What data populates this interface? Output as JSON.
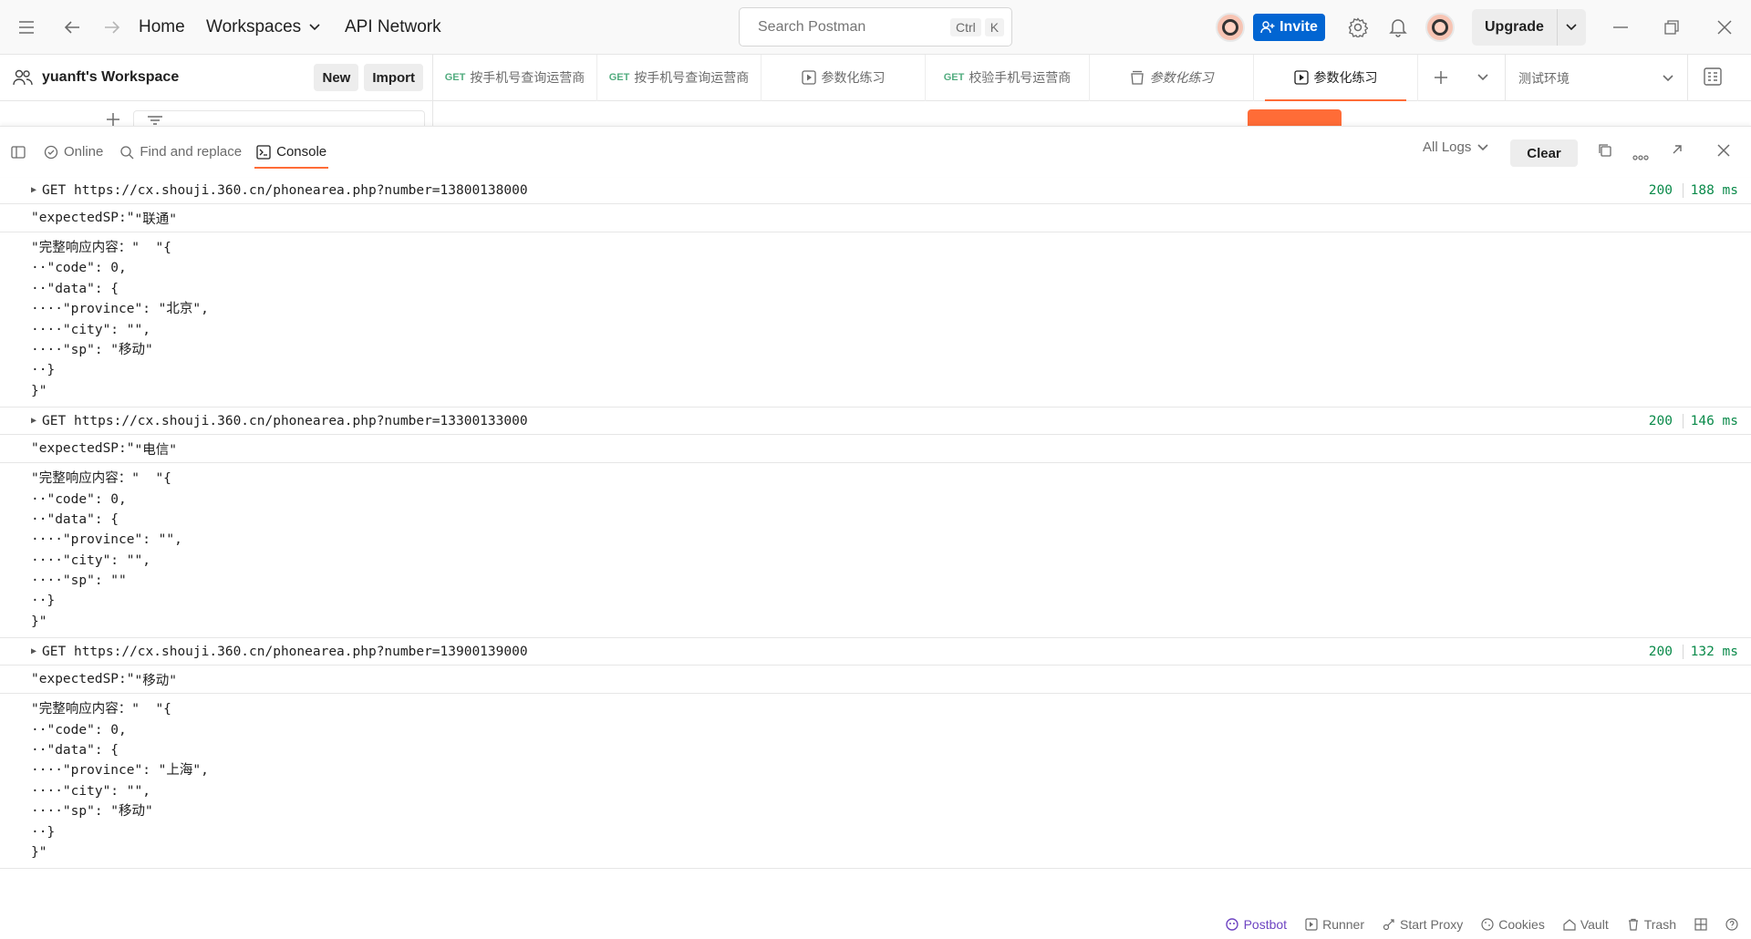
{
  "header": {
    "nav": {
      "home": "Home",
      "workspaces": "Workspaces",
      "api_network": "API Network"
    },
    "search": {
      "placeholder": "Search Postman",
      "shortcut_ctrl": "Ctrl",
      "shortcut_key": "K"
    },
    "invite_label": "Invite",
    "upgrade_label": "Upgrade"
  },
  "workspace": {
    "name": "yuanft's Workspace",
    "new_label": "New",
    "import_label": "Import"
  },
  "tabs": [
    {
      "method": "GET",
      "label": "按手机号查询运营商"
    },
    {
      "method": "GET",
      "label": "按手机号查询运营商"
    },
    {
      "method": "",
      "label": "参数化练习"
    },
    {
      "method": "GET",
      "label": "校验手机号运营商"
    },
    {
      "method": "",
      "label": "参数化练习"
    },
    {
      "method": "",
      "label": "参数化练习"
    }
  ],
  "environment": {
    "selected": "测试环境"
  },
  "console_toolbar": {
    "online": "Online",
    "find_replace": "Find and replace",
    "console": "Console",
    "all_logs": "All Logs",
    "clear": "Clear"
  },
  "logs": [
    {
      "method": "GET",
      "url": "https://cx.shouji.360.cn/phonearea.php?number=13800138000",
      "status": "200",
      "time": "188 ms",
      "expected_key": "\"expectedSP:\"",
      "expected_val": "\"联通\"",
      "full_label": "\"完整响应内容：\"",
      "json_lines": [
        "\"{",
        "··\"code\": 0,",
        "··\"data\": {",
        "····\"province\": \"北京\",",
        "····\"city\": \"\",",
        "····\"sp\": \"移动\"",
        "··}",
        "}\""
      ]
    },
    {
      "method": "GET",
      "url": "https://cx.shouji.360.cn/phonearea.php?number=13300133000",
      "status": "200",
      "time": "146 ms",
      "expected_key": "\"expectedSP:\"",
      "expected_val": "\"电信\"",
      "full_label": "\"完整响应内容：\"",
      "json_lines": [
        "\"{",
        "··\"code\": 0,",
        "··\"data\": {",
        "····\"province\": \"\",",
        "····\"city\": \"\",",
        "····\"sp\": \"\"",
        "··}",
        "}\""
      ]
    },
    {
      "method": "GET",
      "url": "https://cx.shouji.360.cn/phonearea.php?number=13900139000",
      "status": "200",
      "time": "132 ms",
      "expected_key": "\"expectedSP:\"",
      "expected_val": "\"移动\"",
      "full_label": "\"完整响应内容：\"",
      "json_lines": [
        "\"{",
        "··\"code\": 0,",
        "··\"data\": {",
        "····\"province\": \"上海\",",
        "····\"city\": \"\",",
        "····\"sp\": \"移动\"",
        "··}",
        "}\""
      ]
    }
  ],
  "footer": {
    "postbot": "Postbot",
    "runner": "Runner",
    "start_proxy": "Start Proxy",
    "cookies": "Cookies",
    "vault": "Vault",
    "trash": "Trash"
  },
  "colors": {
    "accent": "#ff6c37",
    "invite": "#0265d2",
    "success": "#0a8a4a",
    "postbot": "#6e44c2"
  }
}
